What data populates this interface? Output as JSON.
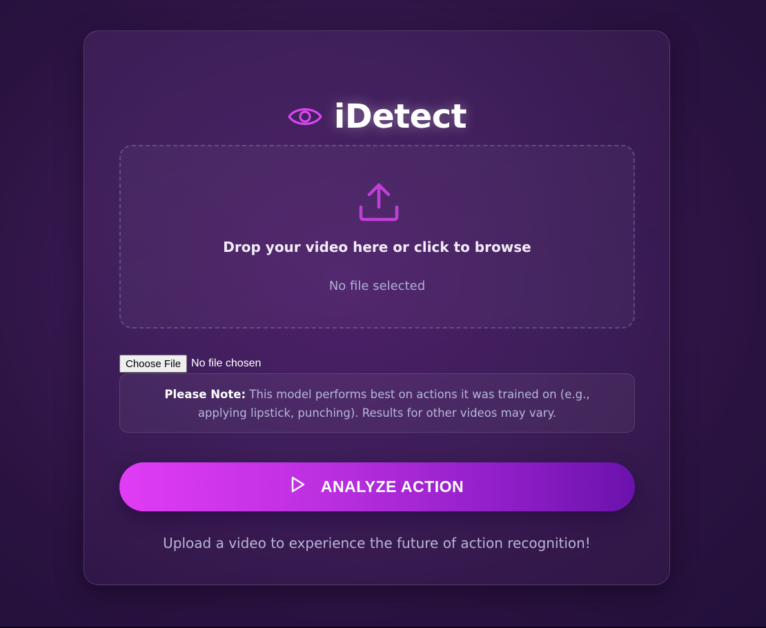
{
  "app": {
    "title": "iDetect",
    "brand_icon": "eye-icon",
    "accent": "#d946ef"
  },
  "dropzone": {
    "icon": "upload-icon",
    "instruction": "Drop your video here or click to browse",
    "status": "No file selected"
  },
  "file_input": {
    "button_label": "Choose File",
    "status": "No file chosen"
  },
  "note": {
    "label": "Please Note:",
    "text": " This model performs best on actions it was trained on (e.g., applying lipstick, punching). Results for other videos may vary."
  },
  "analyze_button": {
    "icon": "play-icon",
    "label": "ANALYZE ACTION"
  },
  "footer": {
    "text": "Upload a video to experience the future of action recognition!"
  },
  "colors": {
    "background": "#2a1240",
    "button_start": "#e13cf5",
    "button_end": "#6b12ac"
  }
}
